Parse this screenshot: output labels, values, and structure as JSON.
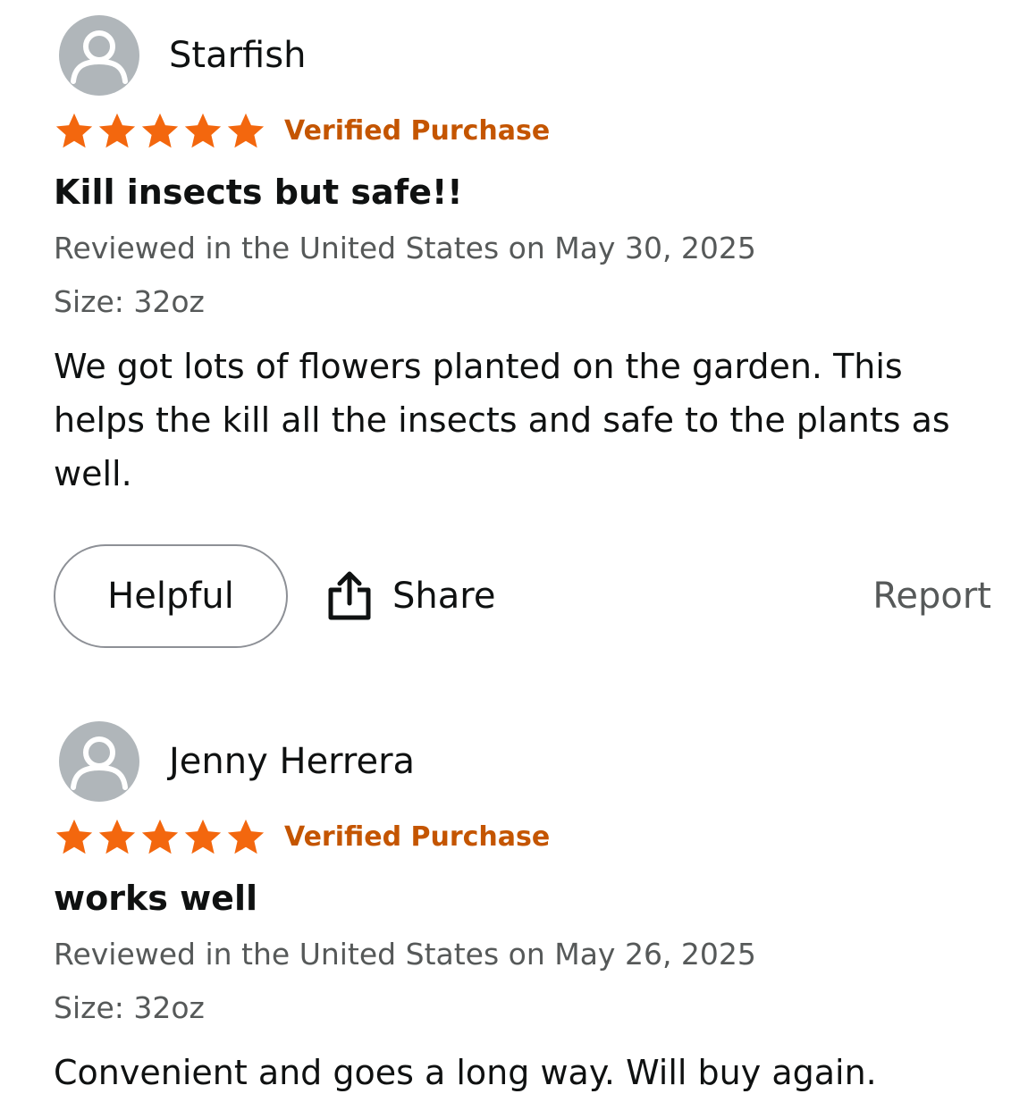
{
  "colors": {
    "star": "#f3670e",
    "verified": "#c45500",
    "avatar_bg": "#b0b6ba",
    "avatar_fg": "#ffffff"
  },
  "reviews": [
    {
      "reviewer": "Starfish",
      "avatar_icon": "user-silhouette-icon",
      "rating": 5,
      "verified_label": "Verified Purchase",
      "title": "Kill insects but safe!!",
      "review_date": "Reviewed in the United States on May 30, 2025",
      "size": "Size: 32oz",
      "body": "We got lots of flowers planted on the garden. This helps the kill all the insects and safe to the plants as well.",
      "actions": {
        "helpful_label": "Helpful",
        "share_label": "Share",
        "share_icon": "share-icon",
        "report_label": "Report"
      }
    },
    {
      "reviewer": "Jenny Herrera",
      "avatar_icon": "user-silhouette-icon",
      "rating": 5,
      "verified_label": "Verified Purchase",
      "title": "works well",
      "review_date": "Reviewed in the United States on May 26, 2025",
      "size": "Size: 32oz",
      "body": "Convenient and goes a long way. Will buy again."
    }
  ]
}
